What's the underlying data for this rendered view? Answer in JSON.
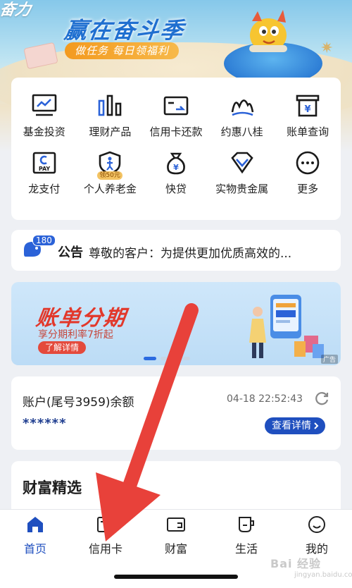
{
  "banner": {
    "corner_logo": "奋力",
    "title": "赢在奋斗季",
    "subtitle": "做任务 每日领福利"
  },
  "quick_menu": {
    "items": [
      {
        "label": "基金投资",
        "icon": "fund-chart-icon"
      },
      {
        "label": "理财产品",
        "icon": "bar-chart-icon"
      },
      {
        "label": "信用卡还款",
        "icon": "card-repay-icon"
      },
      {
        "label": "约惠八桂",
        "icon": "mountain-icon"
      },
      {
        "label": "账单查询",
        "icon": "bill-yuan-icon"
      },
      {
        "label": "龙支付",
        "icon": "pay-icon"
      },
      {
        "label": "个人养老金",
        "icon": "pension-shield-icon",
        "badge": "领50元"
      },
      {
        "label": "快贷",
        "icon": "money-bag-icon"
      },
      {
        "label": "实物贵金属",
        "icon": "diamond-icon"
      },
      {
        "label": "更多",
        "icon": "more-dots-icon"
      }
    ]
  },
  "notice": {
    "count": "180",
    "label": "公告",
    "text": "尊敬的客户：为提供更加优质高效的..."
  },
  "ad": {
    "title": "账单分期",
    "subtitle": "享分期利率7折起",
    "detail_button": "了解详情",
    "tag": "广告",
    "active_slide": 1,
    "slide_count": 4
  },
  "account": {
    "title": "账户(尾号3959)余额",
    "time": "04-18 22:52:43",
    "balance": "******",
    "detail_button": "查看详情"
  },
  "wealth": {
    "title": "财富精选"
  },
  "tabs": [
    {
      "label": "首页",
      "icon": "home-icon",
      "active": true
    },
    {
      "label": "信用卡",
      "icon": "credit-card-icon",
      "active": false
    },
    {
      "label": "财富",
      "icon": "wallet-icon",
      "active": false
    },
    {
      "label": "生活",
      "icon": "cup-icon",
      "active": false
    },
    {
      "label": "我的",
      "icon": "smile-icon",
      "active": false
    }
  ],
  "watermark": {
    "text": "Bai 经验",
    "sub": "jingyan.baidu.com"
  },
  "colors": {
    "brand_blue": "#1f4fbf",
    "arrow_red": "#e8413a",
    "ad_red": "#e2382b",
    "banner_orange": "#f39a1f"
  }
}
